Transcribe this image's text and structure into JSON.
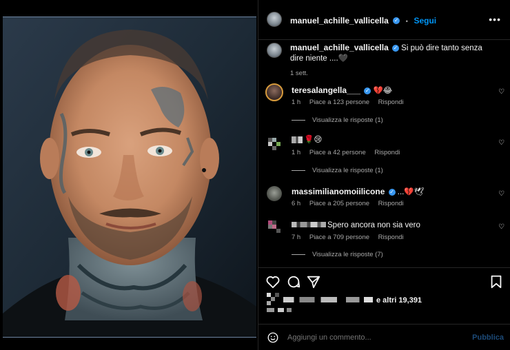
{
  "post": {
    "author": "manuel_achille_vallicella",
    "follow_label": "Segui",
    "more_label": "•••",
    "verified_mark": "✓"
  },
  "caption": {
    "author": "manuel_achille_vallicella",
    "text": "Si può dire tanto senza dire niente ....🖤",
    "time": "1 sett."
  },
  "comments": [
    {
      "author": "teresalangella___",
      "text": "💔😂",
      "time": "1 h",
      "likes": "Piace a 123 persone",
      "reply": "Rispondi",
      "view_replies": "Visualizza le risposte (1)"
    },
    {
      "author": "",
      "text": "🌹😢",
      "time": "1 h",
      "likes": "Piace a 42 persone",
      "reply": "Rispondi",
      "view_replies": "Visualizza le risposte (1)"
    },
    {
      "author": "massimilianomoiilicone",
      "text": "...💔🕊",
      "time": "6 h",
      "likes": "Piace a 205 persone",
      "reply": "Rispondi"
    },
    {
      "author": "",
      "text": "Spero ancora non sia vero",
      "time": "7 h",
      "likes": "Piace a 709 persone",
      "reply": "Rispondi",
      "view_replies": "Visualizza le risposte (7)"
    }
  ],
  "actions": {
    "likes_suffix": "e altri 19,391"
  },
  "add_comment": {
    "placeholder": "Aggiungi un commento...",
    "publish_label": "Pubblica"
  },
  "icons": [
    "like-icon",
    "comment-icon",
    "share-icon",
    "save-icon",
    "emoji-icon",
    "more-icon",
    "heart-icon"
  ],
  "colors": {
    "background": "#000000",
    "link": "#0095f6",
    "verified": "#3897f0",
    "muted": "#a8a8a8",
    "publish_disabled": "#1c4a78"
  }
}
